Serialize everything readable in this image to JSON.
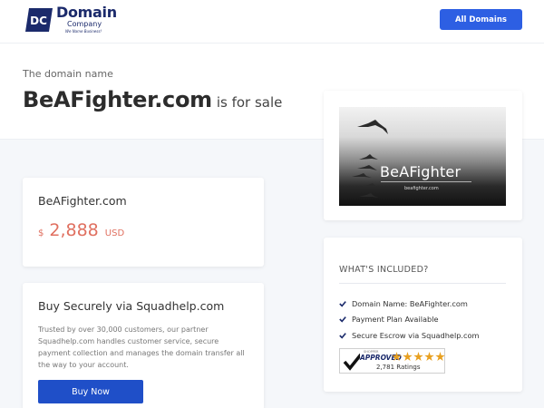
{
  "header": {
    "logo": {
      "badge": "DC",
      "line1": "Domain",
      "line2": "Company",
      "tagline": "We Name Business!"
    },
    "all_domains_label": "All Domains"
  },
  "hero": {
    "intro": "The domain name",
    "domain": "BeAFighter.com",
    "suffix": "is for sale"
  },
  "preview": {
    "brand": "BeAFighter",
    "url": "beafighter.com"
  },
  "price": {
    "domain": "BeAFighter.com",
    "currency_symbol": "$",
    "amount": "2,888",
    "currency_code": "USD"
  },
  "buy": {
    "title": "Buy Securely via Squadhelp.com",
    "description": "Trusted by over 30,000 customers, our partner Squadhelp.com handles customer service, secure payment collection and manages the domain transfer all the way to your account.",
    "button_label": "Buy Now"
  },
  "included": {
    "title": "WHAT'S INCLUDED?",
    "items": [
      {
        "label": "Domain Name: BeAFighter.com",
        "icon": "check-icon"
      },
      {
        "label": "Payment Plan Available",
        "icon": "check-icon"
      },
      {
        "label": "Secure Escrow via Squadhelp.com",
        "icon": "check-icon"
      }
    ],
    "badge": {
      "small": "SHOPPER",
      "word": "APPROVED",
      "ratings": "2,781 Ratings",
      "stars": 5
    }
  },
  "colors": {
    "brand_navy": "#1b2a6b",
    "primary_button": "#2d5fe3",
    "buy_button": "#1f4fc8",
    "price": "#e07060",
    "star": "#e8a020"
  }
}
